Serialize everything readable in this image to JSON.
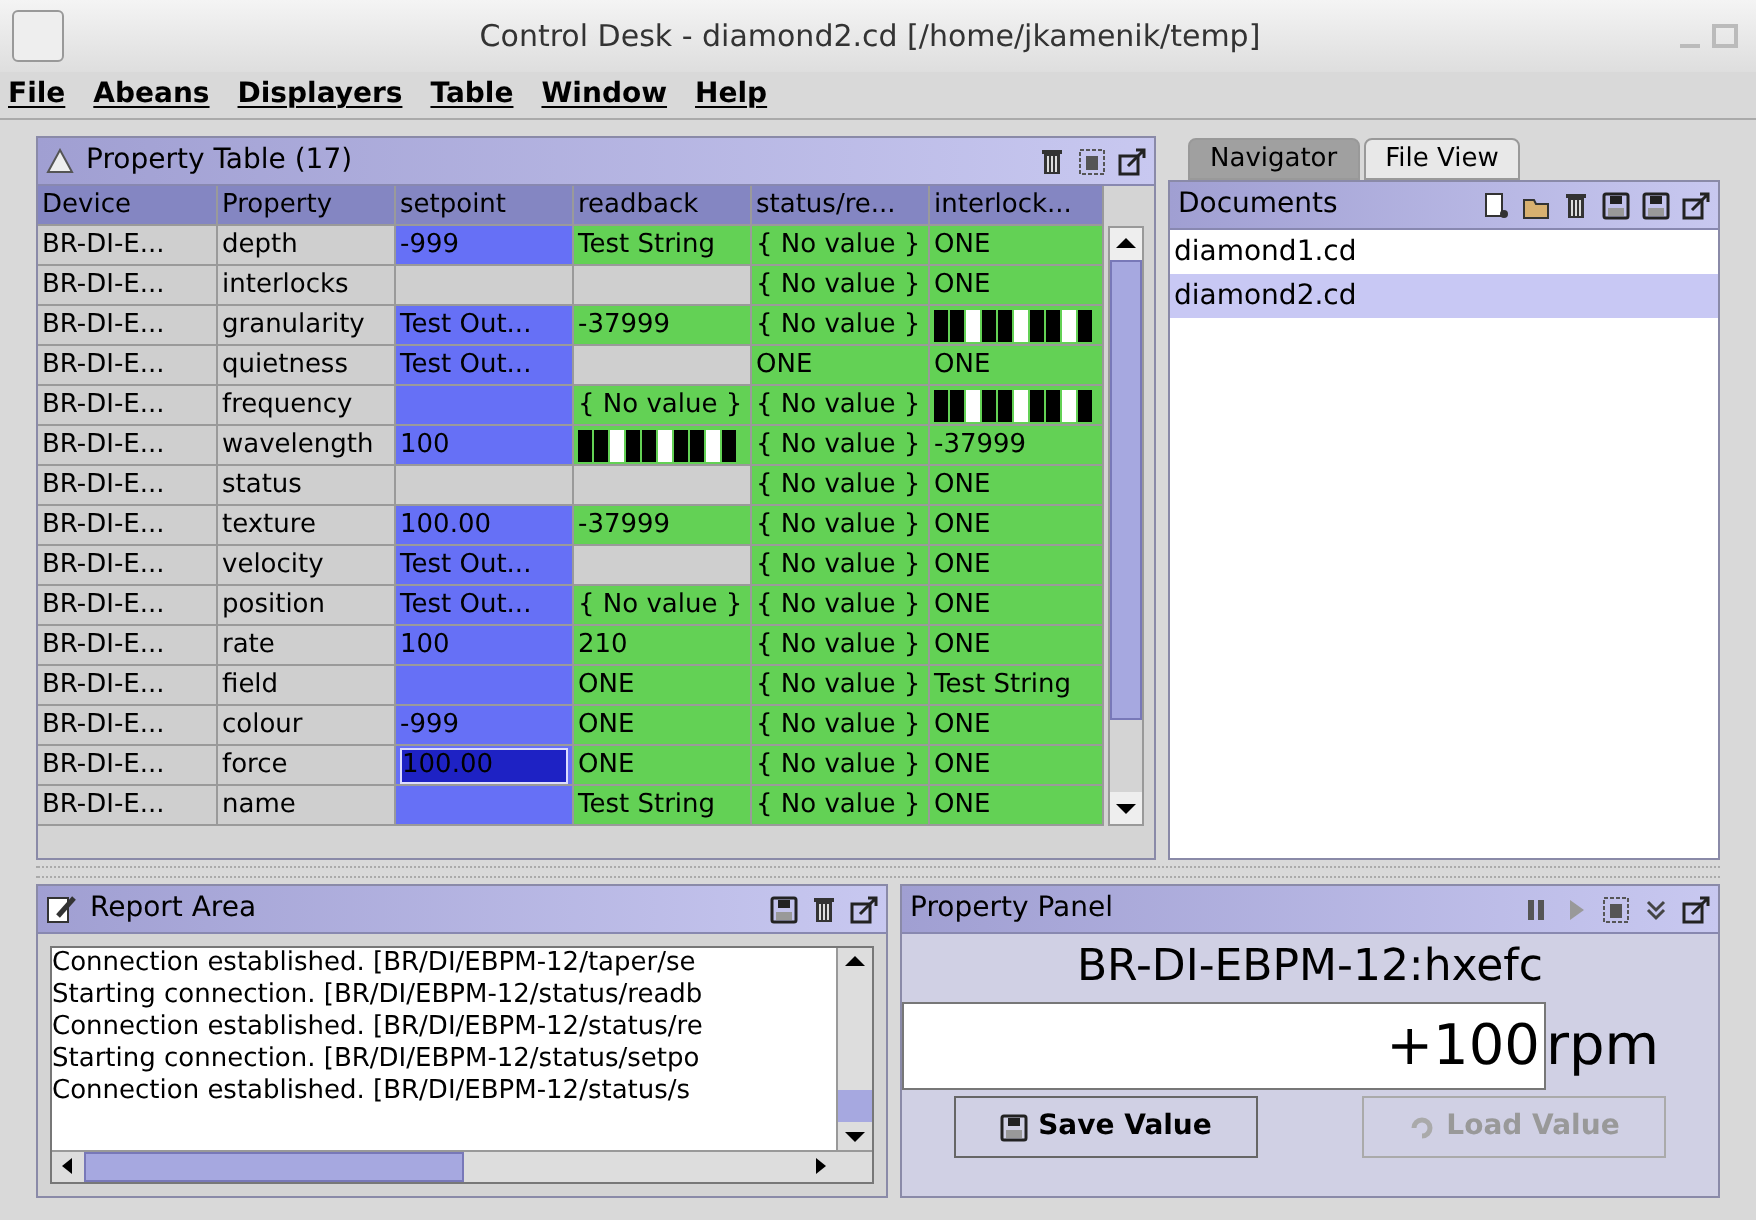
{
  "window": {
    "title": "Control Desk - diamond2.cd  [/home/jkamenik/temp]"
  },
  "menu": [
    "File",
    "Abeans",
    "Displayers",
    "Table",
    "Window",
    "Help"
  ],
  "property_table": {
    "title": "Property Table (17)",
    "columns": [
      "Device",
      "Property",
      "setpoint",
      "readback",
      "status/re...",
      "interlock..."
    ],
    "rows": [
      [
        {
          "kind": "plain",
          "text": "BR-DI-E..."
        },
        {
          "kind": "plain",
          "text": "depth"
        },
        {
          "kind": "set",
          "text": "-999"
        },
        {
          "kind": "ok",
          "text": "Test String"
        },
        {
          "kind": "ok",
          "text": "{ No value }"
        },
        {
          "kind": "ok",
          "text": "ONE"
        }
      ],
      [
        {
          "kind": "plain",
          "text": "BR-DI-E..."
        },
        {
          "kind": "plain",
          "text": "interlocks"
        },
        {
          "kind": "empty"
        },
        {
          "kind": "empty"
        },
        {
          "kind": "ok",
          "text": "{ No value }"
        },
        {
          "kind": "ok",
          "text": "ONE"
        }
      ],
      [
        {
          "kind": "plain",
          "text": "BR-DI-E..."
        },
        {
          "kind": "plain",
          "text": "granularity"
        },
        {
          "kind": "set",
          "text": "Test Out..."
        },
        {
          "kind": "ok",
          "text": "-37999"
        },
        {
          "kind": "ok",
          "text": "{ No value }"
        },
        {
          "kind": "bars"
        }
      ],
      [
        {
          "kind": "plain",
          "text": "BR-DI-E..."
        },
        {
          "kind": "plain",
          "text": "quietness"
        },
        {
          "kind": "set",
          "text": "Test Out..."
        },
        {
          "kind": "empty"
        },
        {
          "kind": "ok",
          "text": "ONE"
        },
        {
          "kind": "ok",
          "text": "ONE"
        }
      ],
      [
        {
          "kind": "plain",
          "text": "BR-DI-E..."
        },
        {
          "kind": "plain",
          "text": "frequency"
        },
        {
          "kind": "set"
        },
        {
          "kind": "ok",
          "text": "{ No value }"
        },
        {
          "kind": "ok",
          "text": "{ No value }"
        },
        {
          "kind": "bars"
        }
      ],
      [
        {
          "kind": "plain",
          "text": "BR-DI-E..."
        },
        {
          "kind": "plain",
          "text": "wavelength"
        },
        {
          "kind": "set",
          "text": "100"
        },
        {
          "kind": "bars"
        },
        {
          "kind": "ok",
          "text": "{ No value }"
        },
        {
          "kind": "ok",
          "text": "-37999"
        }
      ],
      [
        {
          "kind": "plain",
          "text": "BR-DI-E..."
        },
        {
          "kind": "plain",
          "text": "status"
        },
        {
          "kind": "empty"
        },
        {
          "kind": "empty"
        },
        {
          "kind": "ok",
          "text": "{ No value }"
        },
        {
          "kind": "ok",
          "text": "ONE"
        }
      ],
      [
        {
          "kind": "plain",
          "text": "BR-DI-E..."
        },
        {
          "kind": "plain",
          "text": "texture"
        },
        {
          "kind": "set",
          "text": "100.00"
        },
        {
          "kind": "ok",
          "text": "-37999"
        },
        {
          "kind": "ok",
          "text": "{ No value }"
        },
        {
          "kind": "ok",
          "text": "ONE"
        }
      ],
      [
        {
          "kind": "plain",
          "text": "BR-DI-E..."
        },
        {
          "kind": "plain",
          "text": "velocity"
        },
        {
          "kind": "set",
          "text": "Test Out..."
        },
        {
          "kind": "empty"
        },
        {
          "kind": "ok",
          "text": "{ No value }"
        },
        {
          "kind": "ok",
          "text": "ONE"
        }
      ],
      [
        {
          "kind": "plain",
          "text": "BR-DI-E..."
        },
        {
          "kind": "plain",
          "text": "position"
        },
        {
          "kind": "set",
          "text": "Test Out..."
        },
        {
          "kind": "ok",
          "text": "{ No value }"
        },
        {
          "kind": "ok",
          "text": "{ No value }"
        },
        {
          "kind": "ok",
          "text": "ONE"
        }
      ],
      [
        {
          "kind": "plain",
          "text": "BR-DI-E..."
        },
        {
          "kind": "plain",
          "text": "rate"
        },
        {
          "kind": "set",
          "text": "100"
        },
        {
          "kind": "ok",
          "text": "210"
        },
        {
          "kind": "ok",
          "text": "{ No value }"
        },
        {
          "kind": "ok",
          "text": "ONE"
        }
      ],
      [
        {
          "kind": "plain",
          "text": "BR-DI-E..."
        },
        {
          "kind": "plain",
          "text": "field"
        },
        {
          "kind": "set"
        },
        {
          "kind": "ok",
          "text": "ONE"
        },
        {
          "kind": "ok",
          "text": "{ No value }"
        },
        {
          "kind": "ok",
          "text": "Test String"
        }
      ],
      [
        {
          "kind": "plain",
          "text": "BR-DI-E..."
        },
        {
          "kind": "plain",
          "text": "colour"
        },
        {
          "kind": "set",
          "text": "-999"
        },
        {
          "kind": "ok",
          "text": "ONE"
        },
        {
          "kind": "ok",
          "text": "{ No value }"
        },
        {
          "kind": "ok",
          "text": "ONE"
        }
      ],
      [
        {
          "kind": "plain",
          "text": "BR-DI-E..."
        },
        {
          "kind": "plain",
          "text": "force"
        },
        {
          "kind": "editing",
          "text": "100.00"
        },
        {
          "kind": "ok",
          "text": "ONE"
        },
        {
          "kind": "ok",
          "text": "{ No value }"
        },
        {
          "kind": "ok",
          "text": "ONE"
        }
      ],
      [
        {
          "kind": "plain",
          "text": "BR-DI-E..."
        },
        {
          "kind": "plain",
          "text": "name"
        },
        {
          "kind": "set"
        },
        {
          "kind": "ok",
          "text": "Test String"
        },
        {
          "kind": "ok",
          "text": "{ No value }"
        },
        {
          "kind": "ok",
          "text": "ONE"
        }
      ]
    ]
  },
  "right_tabs": [
    {
      "label": "Navigator",
      "selected": false
    },
    {
      "label": "File View",
      "selected": true
    }
  ],
  "documents": {
    "title": "Documents",
    "items": [
      {
        "label": "diamond1.cd",
        "selected": false
      },
      {
        "label": "diamond2.cd",
        "selected": true
      }
    ]
  },
  "report_area": {
    "title": "Report Area",
    "lines": [
      "Connection established. [BR/DI/EBPM-12/taper/se",
      "Starting connection. [BR/DI/EBPM-12/status/readb",
      "Connection established. [BR/DI/EBPM-12/status/re",
      "Starting connection. [BR/DI/EBPM-12/status/setpo",
      "Connection established. [BR/DI/EBPM-12/status/s"
    ]
  },
  "property_panel": {
    "title": "Property Panel",
    "name": "BR-DI-EBPM-12:hxefc",
    "value": "+100",
    "unit": "rpm",
    "buttons": [
      {
        "label": "Save Value",
        "disabled": false
      },
      {
        "label": "Load Value",
        "disabled": true
      }
    ]
  }
}
